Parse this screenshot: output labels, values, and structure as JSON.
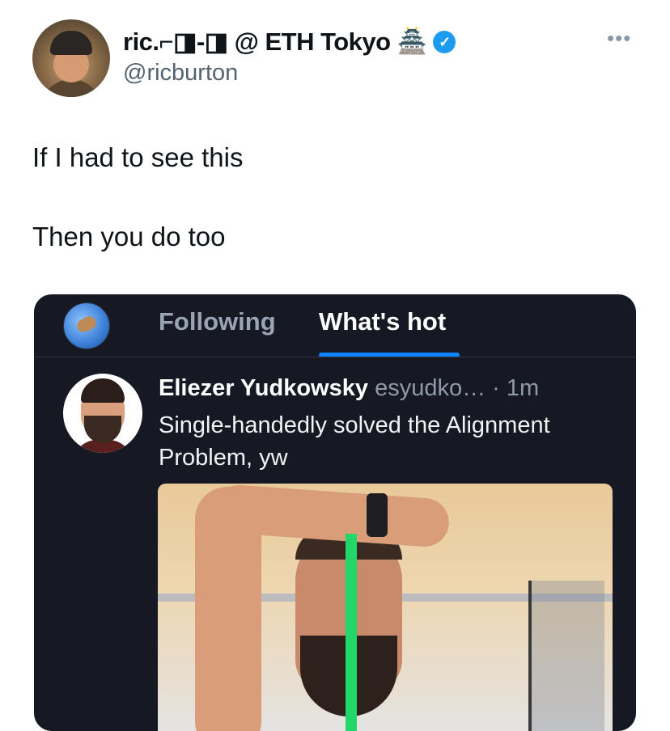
{
  "tweet": {
    "display_name": "ric.⌐◨-◨ @ ETH Tokyo",
    "name_emoji": "🏯",
    "handle": "@ricburton",
    "more_glyph": "•••",
    "verified_glyph": "✓",
    "text_line1": "If I had to see this",
    "text_line2": "Then you do too"
  },
  "embedded": {
    "tabs": [
      "Following",
      "What's hot"
    ],
    "active_tab": "What's hot",
    "post": {
      "author_name": "Eliezer Yudkowsky",
      "author_handle_time": "esyudko… · 1m",
      "text": "Single-handedly solved the Alignment Problem, yw"
    }
  },
  "colors": {
    "verified": "#1d9bf0",
    "card_bg": "#161823",
    "tab_accent": "#1083fe",
    "image_line": "#22d66a"
  }
}
